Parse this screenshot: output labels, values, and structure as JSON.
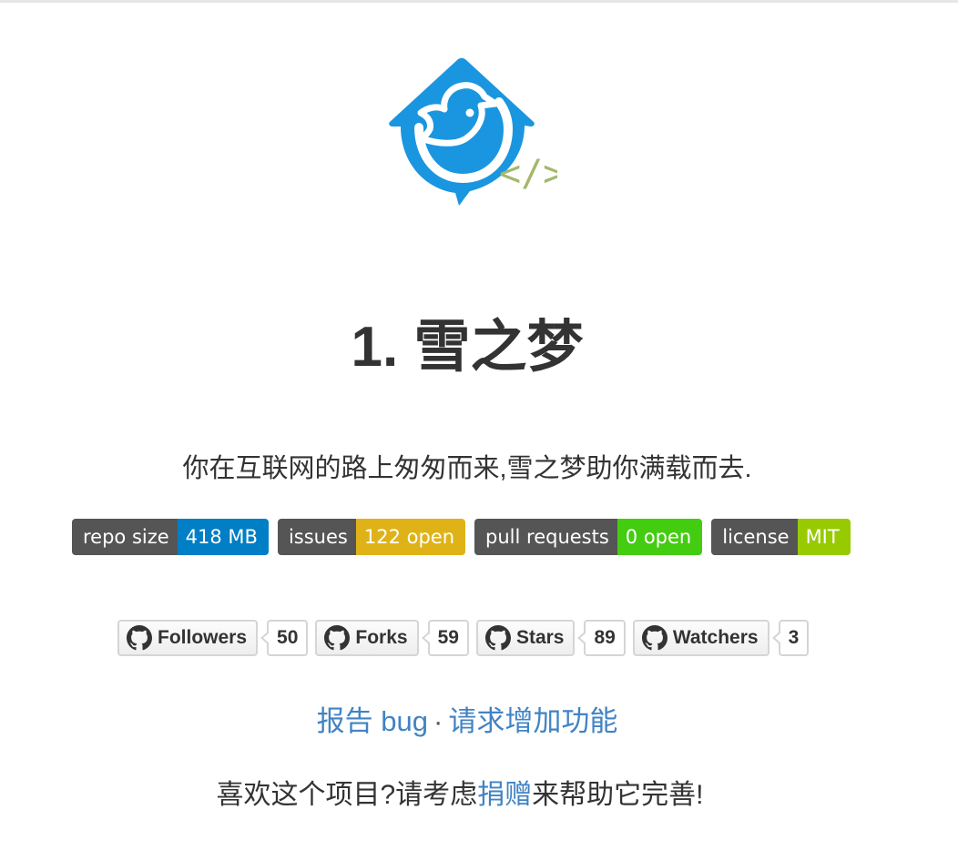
{
  "header": {
    "title": "1. 雪之梦",
    "tagline": "你在互联网的路上匆匆而来,雪之梦助你满载而去."
  },
  "badges": [
    {
      "label": "repo size",
      "value": "418 MB",
      "color": "#007ec6"
    },
    {
      "label": "issues",
      "value": "122 open",
      "color": "#dfb317"
    },
    {
      "label": "pull requests",
      "value": "0 open",
      "color": "#4c1"
    },
    {
      "label": "license",
      "value": "MIT",
      "color": "#97ca00"
    }
  ],
  "github_buttons": [
    {
      "label": "Followers",
      "count": "50",
      "icon": "github-icon"
    },
    {
      "label": "Forks",
      "count": "59",
      "icon": "github-icon"
    },
    {
      "label": "Stars",
      "count": "89",
      "icon": "github-icon"
    },
    {
      "label": "Watchers",
      "count": "3",
      "icon": "github-icon"
    }
  ],
  "links": {
    "report_bug": "报告 bug",
    "separator": "·",
    "feature_request": "请求增加功能"
  },
  "donate": {
    "prefix": "喜欢这个项目?请考虑",
    "link": "捐赠",
    "suffix": "来帮助它完善!"
  },
  "colors": {
    "logo_blue": "#1a96e0",
    "code_symbol": "#a3b86c",
    "link": "#4183c4"
  }
}
